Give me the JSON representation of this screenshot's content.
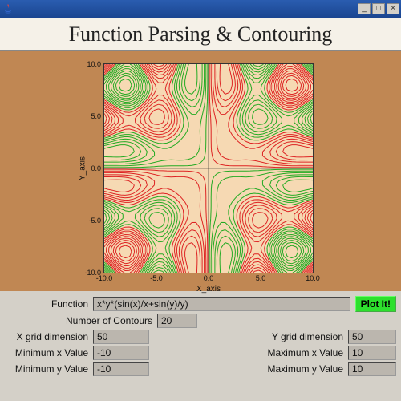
{
  "window": {
    "title": "",
    "heading": "Function Parsing & Contouring",
    "min_icon": "_",
    "max_icon": "□",
    "close_icon": "×"
  },
  "controls": {
    "function_label": "Function",
    "function_value": "x*y*(sin(x)/x+sin(y)/y)",
    "plot_button": "Plot It!",
    "ncontours_label": "Number of Contours",
    "ncontours_value": "20",
    "xgrid_label": "X grid dimension",
    "xgrid_value": "50",
    "ygrid_label": "Y grid dimension",
    "ygrid_value": "50",
    "xmin_label": "Minimum x Value",
    "xmin_value": "-10",
    "xmax_label": "Maximum x Value",
    "xmax_value": "10",
    "ymin_label": "Minimum y Value",
    "ymin_value": "-10",
    "ymax_label": "Maximum y Value",
    "ymax_value": "10"
  },
  "chart_data": {
    "type": "contour",
    "title": "",
    "xlabel": "X_axis",
    "ylabel": "Y_axis",
    "xlim": [
      -10,
      10
    ],
    "ylim": [
      -10,
      10
    ],
    "xticks": [
      -10,
      -5,
      0,
      5,
      10
    ],
    "yticks": [
      -10,
      -5,
      0,
      5,
      10
    ],
    "xtick_labels": [
      "-10.0",
      "-5.0",
      "0.0",
      "5.0",
      "10.0"
    ],
    "ytick_labels": [
      "-10.0",
      "-5.0",
      "0.0",
      "5.0",
      "10.0"
    ],
    "function": "x*y*(sin(x)/x + sin(y)/y)",
    "n_contours": 20,
    "grid_nx": 50,
    "grid_ny": 50,
    "contour_color_low": "#22aa22",
    "contour_color_high": "#dd2222",
    "background": "#f6d9b3"
  }
}
